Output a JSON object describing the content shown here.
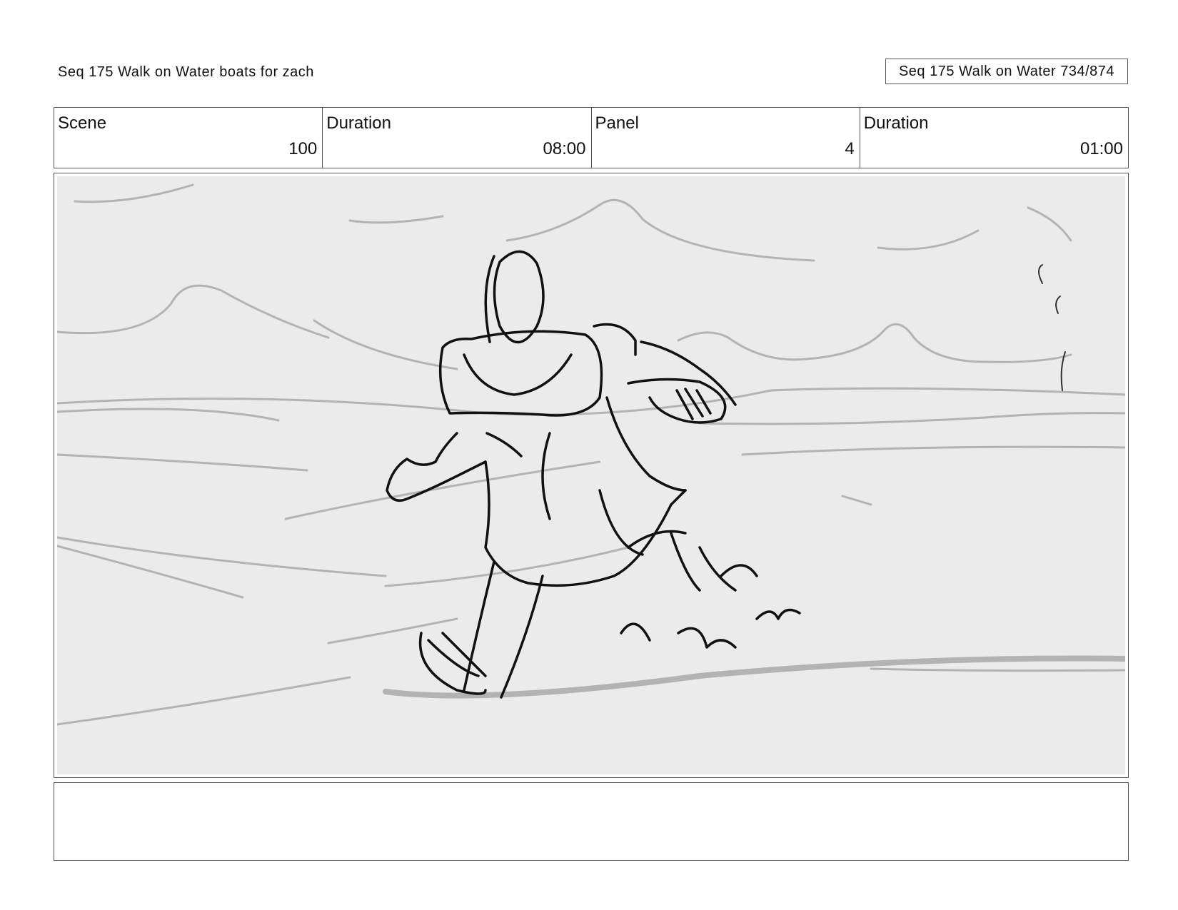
{
  "header": {
    "left_title": "Seq 175 Walk on Water  boats for zach",
    "right_title": "Seq 175 Walk on Water 734/874"
  },
  "info": {
    "scene_label": "Scene",
    "scene_value": "100",
    "scene_duration_label": "Duration",
    "scene_duration_value": "08:00",
    "panel_label": "Panel",
    "panel_value": "4",
    "panel_duration_label": "Duration",
    "panel_duration_value": "01:00"
  },
  "panel": {
    "background_color": "#ebebeb",
    "figure_stroke": "#111111",
    "wave_stroke": "#b3b3b3"
  },
  "notes": {
    "text": ""
  }
}
